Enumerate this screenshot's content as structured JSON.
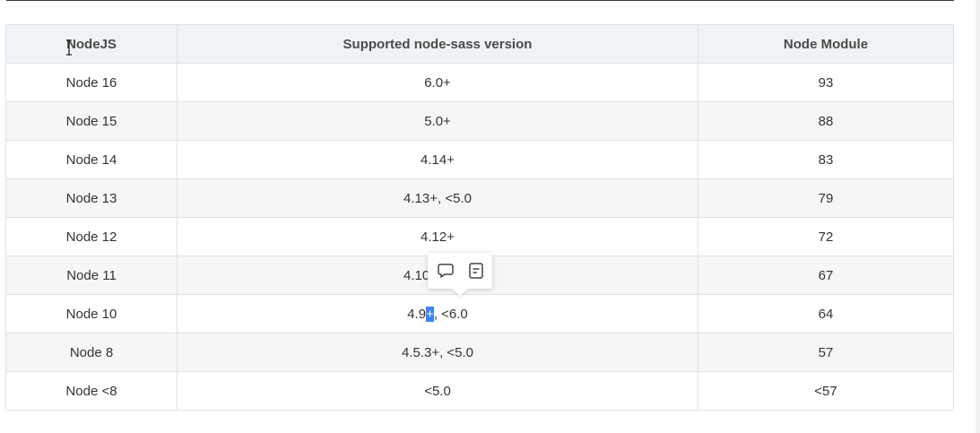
{
  "table": {
    "headers": [
      "NodeJS",
      "Supported node-sass version",
      "Node Module"
    ],
    "rows": [
      [
        "Node 16",
        "6.0+",
        "93"
      ],
      [
        "Node 15",
        "5.0+",
        "88"
      ],
      [
        "Node 14",
        "4.14+",
        "83"
      ],
      [
        "Node 13",
        "4.13+, <5.0",
        "79"
      ],
      [
        "Node 12",
        "4.12+",
        "72"
      ],
      [
        "Node 11",
        "4.10+, <5.0",
        "67"
      ],
      [
        "Node 10",
        "4.9+, <6.0",
        "64"
      ],
      [
        "Node 8",
        "4.5.3+, <5.0",
        "57"
      ],
      [
        "Node <8",
        "<5.0",
        "<57"
      ]
    ],
    "selection": {
      "before": "4.9",
      "selected": "+",
      "after": ", <6.0"
    }
  },
  "popover": {
    "icons": [
      "comment-icon",
      "note-icon"
    ]
  },
  "colors": {
    "header_bg": "#eff3f6",
    "stripe_bg": "#f6f6f6",
    "border": "#dfe2e5",
    "selection": "#3b82f6"
  }
}
